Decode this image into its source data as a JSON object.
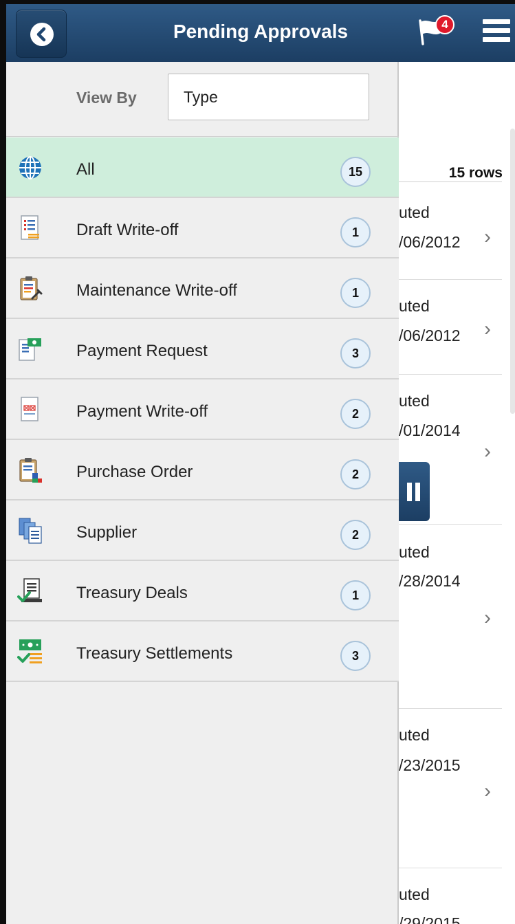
{
  "colors": {
    "header": "#234a72",
    "active_row": "#cfeedc",
    "badge_red": "#e0192b"
  },
  "header": {
    "title": "Pending Approvals",
    "notification_count": "4"
  },
  "panel": {
    "view_by_label": "View By",
    "view_by_value": "Type",
    "items": [
      {
        "label": "All",
        "count": "15",
        "icon": "globe-icon"
      },
      {
        "label": "Draft Write-off",
        "count": "1",
        "icon": "document-list-icon"
      },
      {
        "label": "Maintenance Write-off",
        "count": "1",
        "icon": "clipboard-wrench-icon"
      },
      {
        "label": "Payment Request",
        "count": "3",
        "icon": "payment-document-icon"
      },
      {
        "label": "Payment Write-off",
        "count": "2",
        "icon": "writeoff-document-icon"
      },
      {
        "label": "Purchase Order",
        "count": "2",
        "icon": "clipboard-order-icon"
      },
      {
        "label": "Supplier",
        "count": "2",
        "icon": "supplier-documents-icon"
      },
      {
        "label": "Treasury Deals",
        "count": "1",
        "icon": "treasury-deal-icon"
      },
      {
        "label": "Treasury Settlements",
        "count": "3",
        "icon": "treasury-settlement-icon"
      }
    ]
  },
  "background_list": {
    "rows_label": "15 rows",
    "rows": [
      {
        "status": "uted",
        "date": "/06/2012"
      },
      {
        "status": "uted",
        "date": "/06/2012"
      },
      {
        "status": "uted",
        "date": "/01/2014"
      },
      {
        "status": "uted",
        "date": "/28/2014"
      },
      {
        "status": "uted",
        "date": "/23/2015"
      },
      {
        "status": "uted",
        "date": "/29/2015"
      }
    ]
  }
}
